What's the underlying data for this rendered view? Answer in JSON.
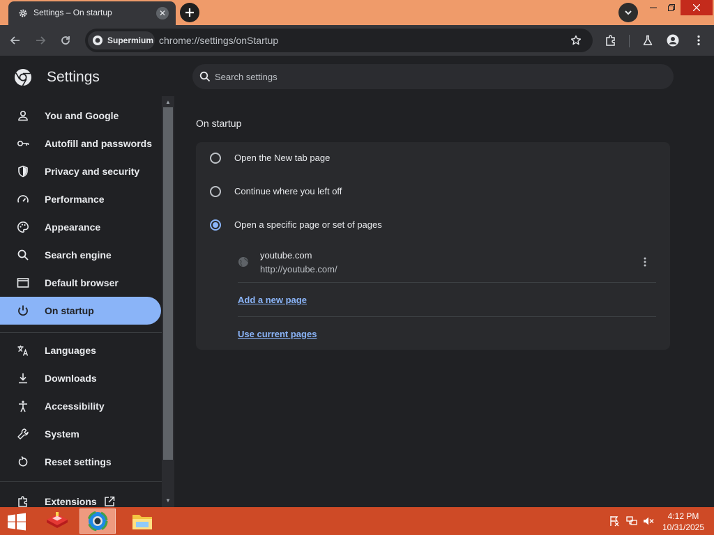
{
  "browser": {
    "tab_title": "Settings – On startup",
    "profile_chip": "Supermium",
    "url": "chrome://settings/onStartup"
  },
  "settings": {
    "title": "Settings",
    "search_placeholder": "Search settings",
    "nav_items": [
      {
        "label": "You and Google",
        "icon": "person-icon"
      },
      {
        "label": "Autofill and passwords",
        "icon": "key-icon"
      },
      {
        "label": "Privacy and security",
        "icon": "shield-icon"
      },
      {
        "label": "Performance",
        "icon": "speedometer-icon"
      },
      {
        "label": "Appearance",
        "icon": "palette-icon"
      },
      {
        "label": "Search engine",
        "icon": "search-icon"
      },
      {
        "label": "Default browser",
        "icon": "browser-window-icon"
      },
      {
        "label": "On startup",
        "icon": "power-icon",
        "active": true
      },
      {
        "label": "Languages",
        "icon": "translate-icon"
      },
      {
        "label": "Downloads",
        "icon": "download-icon"
      },
      {
        "label": "Accessibility",
        "icon": "accessibility-icon"
      },
      {
        "label": "System",
        "icon": "wrench-icon"
      },
      {
        "label": "Reset settings",
        "icon": "reset-icon"
      },
      {
        "label": "Extensions",
        "icon": "puzzle-icon"
      }
    ],
    "section_title": "On startup",
    "options": [
      {
        "label": "Open the New tab page",
        "checked": false
      },
      {
        "label": "Continue where you left off",
        "checked": false
      },
      {
        "label": "Open a specific page or set of pages",
        "checked": true
      }
    ],
    "startup_page": {
      "title": "youtube.com",
      "url": "http://youtube.com/"
    },
    "add_page_link": "Add a new page",
    "use_current_link": "Use current pages"
  },
  "taskbar": {
    "time": "4:12 PM",
    "date": "10/31/2025"
  },
  "colors": {
    "titlebar": "#ef9b6a",
    "accent": "#8ab4f8",
    "taskbar": "#ce4a26"
  }
}
